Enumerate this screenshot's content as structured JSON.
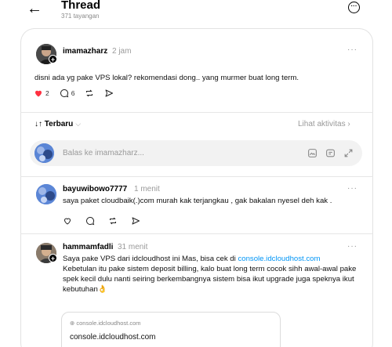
{
  "header": {
    "back_icon": "arrow-left-icon",
    "title": "Thread",
    "subtitle": "371 tayangan",
    "more_icon": "more-circle-icon"
  },
  "post": {
    "username": "imamazharz",
    "time": "2 jam",
    "text": "disni ada yg pake VPS lokal? rekomendasi dong.. yang murmer buat long term.",
    "likes": "2",
    "comments": "6",
    "like_color": "#ff3040"
  },
  "sort": {
    "label": "Terbaru",
    "activity": "Lihat aktivitas"
  },
  "reply_box": {
    "placeholder": "Balas ke imamazharz..."
  },
  "replies": [
    {
      "username": "bayuwibowo7777",
      "time": "1 menit",
      "text": "saya paket cloudbaik(.)com murah kak terjangkau , gak bakalan nyesel deh kak ."
    },
    {
      "username": "hammamfadli",
      "time": "31 menit",
      "text_before_link": "Saya pake VPS dari idcloudhost ini Mas, bisa cek di ",
      "link": "console.idcloudhost.com",
      "text_after_link": "Kebetulan itu pake sistem deposit billing, kalo buat long term cocok sihh awal-awal pake spek kecil dulu nanti seiring berkembangnya sistem bisa ikut upgrade juga speknya ikut kebutuhan",
      "emoji": "👌",
      "link_card": {
        "domain": "console.idcloudhost.com",
        "title": "console.idcloudhost.com"
      }
    }
  ],
  "colors": {
    "link": "#0095f6",
    "muted": "#9a9a9a"
  }
}
